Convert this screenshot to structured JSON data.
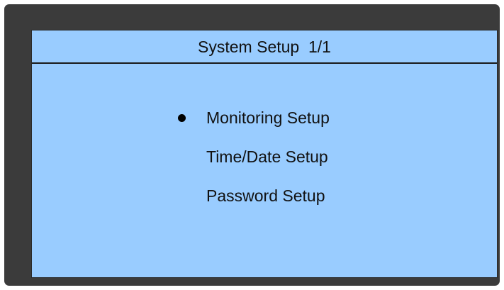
{
  "window": {
    "title": "System Setup  1/1"
  },
  "menu": {
    "selected_index": 0,
    "items": [
      {
        "label": "Monitoring Setup"
      },
      {
        "label": "Time/Date Setup"
      },
      {
        "label": "Password Setup"
      }
    ]
  },
  "colors": {
    "screen_background": "#99ccff",
    "frame": "#3b3b3b",
    "text": "#111111"
  }
}
